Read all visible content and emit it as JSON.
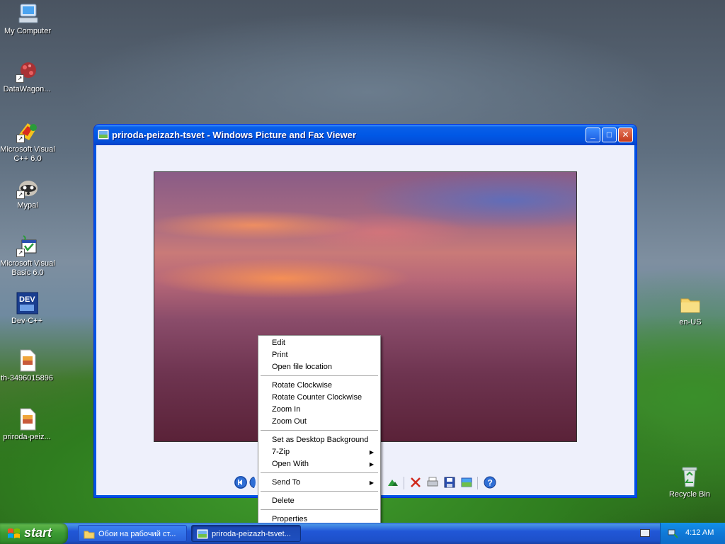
{
  "desktop": {
    "icons": [
      {
        "label": "My Computer"
      },
      {
        "label": "DataWagon..."
      },
      {
        "label": "Microsoft Visual C++ 6.0"
      },
      {
        "label": "Mypal"
      },
      {
        "label": "Microsoft Visual Basic 6.0"
      },
      {
        "label": "Dev-C++"
      },
      {
        "label": "th-3496015896"
      },
      {
        "label": "priroda-peiz..."
      },
      {
        "label": "en-US"
      },
      {
        "label": "Recycle Bin"
      }
    ]
  },
  "window": {
    "title": "priroda-peizazh-tsvet - Windows Picture and Fax Viewer",
    "minimize": "_",
    "maximize": "□",
    "close": "✕"
  },
  "context_menu": {
    "items": [
      "Edit",
      "Print",
      "Open file location",
      "Rotate Clockwise",
      "Rotate Counter Clockwise",
      "Zoom In",
      "Zoom Out",
      "Set as Desktop Background",
      "7-Zip",
      "Open With",
      "Send To",
      "Delete",
      "Properties"
    ],
    "submenu_arrow": "▶"
  },
  "taskbar": {
    "start_label": "start",
    "tasks": [
      {
        "label": "Обои на рабочий ст..."
      },
      {
        "label": "priroda-peizazh-tsvet..."
      }
    ],
    "clock": "4:12 AM"
  },
  "colors": {
    "title_blue": "#0058e6",
    "start_green": "#3a9a32",
    "close_red": "#c5391b"
  }
}
